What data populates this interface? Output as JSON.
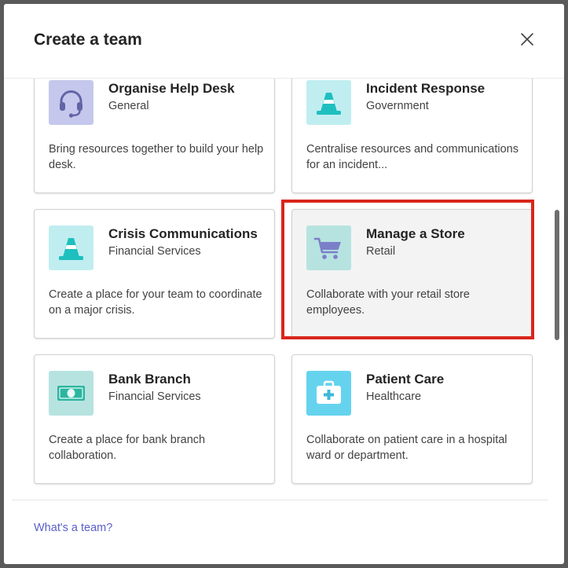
{
  "dialog": {
    "title": "Create a team",
    "close_icon": "close-icon"
  },
  "templates": [
    {
      "title": "Organise Help Desk",
      "category": "General",
      "description": "Bring resources together to build your help desk.",
      "icon": "headset-icon",
      "icon_bg": "#c5c8ec",
      "icon_color": "#6264a7"
    },
    {
      "title": "Incident Response",
      "category": "Government",
      "description": "Centralise resources and communications for an incident...",
      "icon": "traffic-cone-icon",
      "icon_bg": "#c0eef0",
      "icon_color": "#1fbfbf"
    },
    {
      "title": "Crisis Communications",
      "category": "Financial Services",
      "description": "Create a place for your team to coordinate on a major crisis.",
      "icon": "traffic-cone-icon",
      "icon_bg": "#c0eef0",
      "icon_color": "#1fbfbf"
    },
    {
      "title": "Manage a Store",
      "category": "Retail",
      "description": "Collaborate with your retail store employees.",
      "icon": "shopping-cart-icon",
      "icon_bg": "#b6e3e0",
      "icon_color": "#7b7fc9",
      "selected": true
    },
    {
      "title": "Bank Branch",
      "category": "Financial Services",
      "description": "Create a place for bank branch collaboration.",
      "icon": "banknote-icon",
      "icon_bg": "#b6e3e0",
      "icon_color": "#2bb5a0"
    },
    {
      "title": "Patient Care",
      "category": "Healthcare",
      "description": "Collaborate on patient care in a hospital ward or department.",
      "icon": "medical-kit-icon",
      "icon_bg": "#66d3ee",
      "icon_color": "#ffffff"
    }
  ],
  "footer": {
    "link_label": "What's a team?"
  },
  "colors": {
    "accent_link": "#5b5fc7",
    "selection_outline": "#d9261c"
  }
}
